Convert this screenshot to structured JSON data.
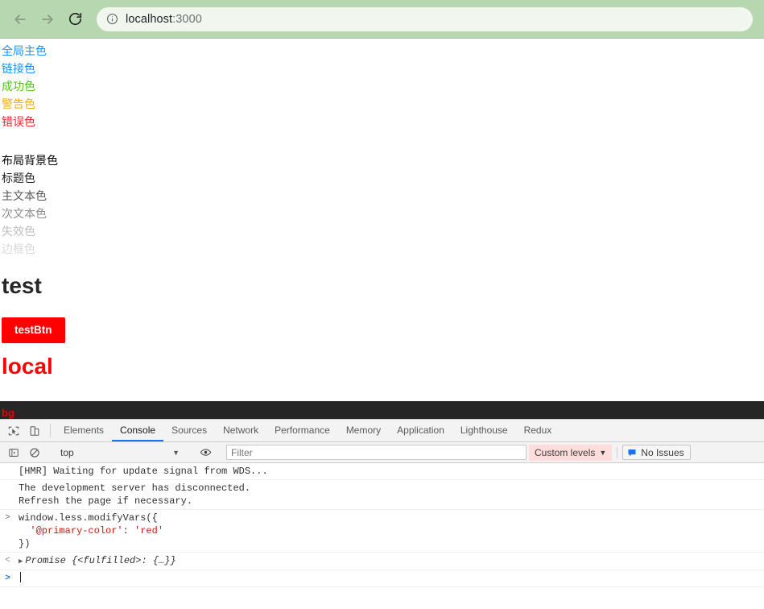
{
  "browser": {
    "back_label": "Back",
    "forward_label": "Forward",
    "reload_label": "Reload",
    "url_host": "localhost",
    "url_port": ":3000",
    "info_icon": "info-circle-icon"
  },
  "page": {
    "swatches_primary": [
      {
        "label": "全局主色",
        "color": "#1890ff"
      },
      {
        "label": "链接色",
        "color": "#1890ff"
      },
      {
        "label": "成功色",
        "color": "#52c41a"
      },
      {
        "label": "警告色",
        "color": "#faad14"
      },
      {
        "label": "错误色",
        "color": "#f5222d"
      }
    ],
    "swatches_neutral": [
      {
        "label": "布局背景色",
        "color": "#000000"
      },
      {
        "label": "标题色",
        "color": "#262626"
      },
      {
        "label": "主文本色",
        "color": "#595959"
      },
      {
        "label": "次文本色",
        "color": "#8c8c8c"
      },
      {
        "label": "失效色",
        "color": "#bfbfbf"
      },
      {
        "label": "边框色",
        "color": "#d9d9d9"
      }
    ],
    "heading_test": "test",
    "button_label": "testBtn",
    "heading_local": "local",
    "bg_bar_label": "bg",
    "colors": {
      "button_bg": "#ff0000",
      "button_text": "#ffffff",
      "local_heading": "#ff0000",
      "bg_bar_bg": "#262626",
      "bg_bar_text": "#e50000"
    }
  },
  "devtools": {
    "icons": {
      "inspect": "inspect-element-icon",
      "device": "device-toolbar-icon",
      "sidebar": "console-sidebar-icon",
      "clear": "clear-console-icon",
      "eye": "eye-icon",
      "issues": "issues-message-icon"
    },
    "tabs": [
      {
        "label": "Elements",
        "active": false
      },
      {
        "label": "Console",
        "active": true
      },
      {
        "label": "Sources",
        "active": false
      },
      {
        "label": "Network",
        "active": false
      },
      {
        "label": "Performance",
        "active": false
      },
      {
        "label": "Memory",
        "active": false
      },
      {
        "label": "Application",
        "active": false
      },
      {
        "label": "Lighthouse",
        "active": false
      },
      {
        "label": "Redux",
        "active": false
      }
    ],
    "filterbar": {
      "context": "top",
      "context_caret": "▼",
      "filter_placeholder": "Filter",
      "filter_value": "",
      "levels_label": "Custom levels",
      "levels_caret": "▼",
      "issues_label": "No Issues"
    },
    "console": {
      "messages": [
        {
          "gutter": "",
          "text": "[HMR] Waiting for update signal from WDS..."
        },
        {
          "gutter": "",
          "text": "The development server has disconnected.\nRefresh the page if necessary."
        }
      ],
      "input": {
        "gutter": ">",
        "line1": "window.less.modifyVars({",
        "line2_key": "'@primary-color'",
        "line2_sep": ": ",
        "line2_val": "'red'",
        "line3": "})"
      },
      "result": {
        "gutter": "<",
        "triangle": "▶",
        "text": "Promise {<fulfilled>: {…}}"
      },
      "prompt": ">"
    }
  }
}
